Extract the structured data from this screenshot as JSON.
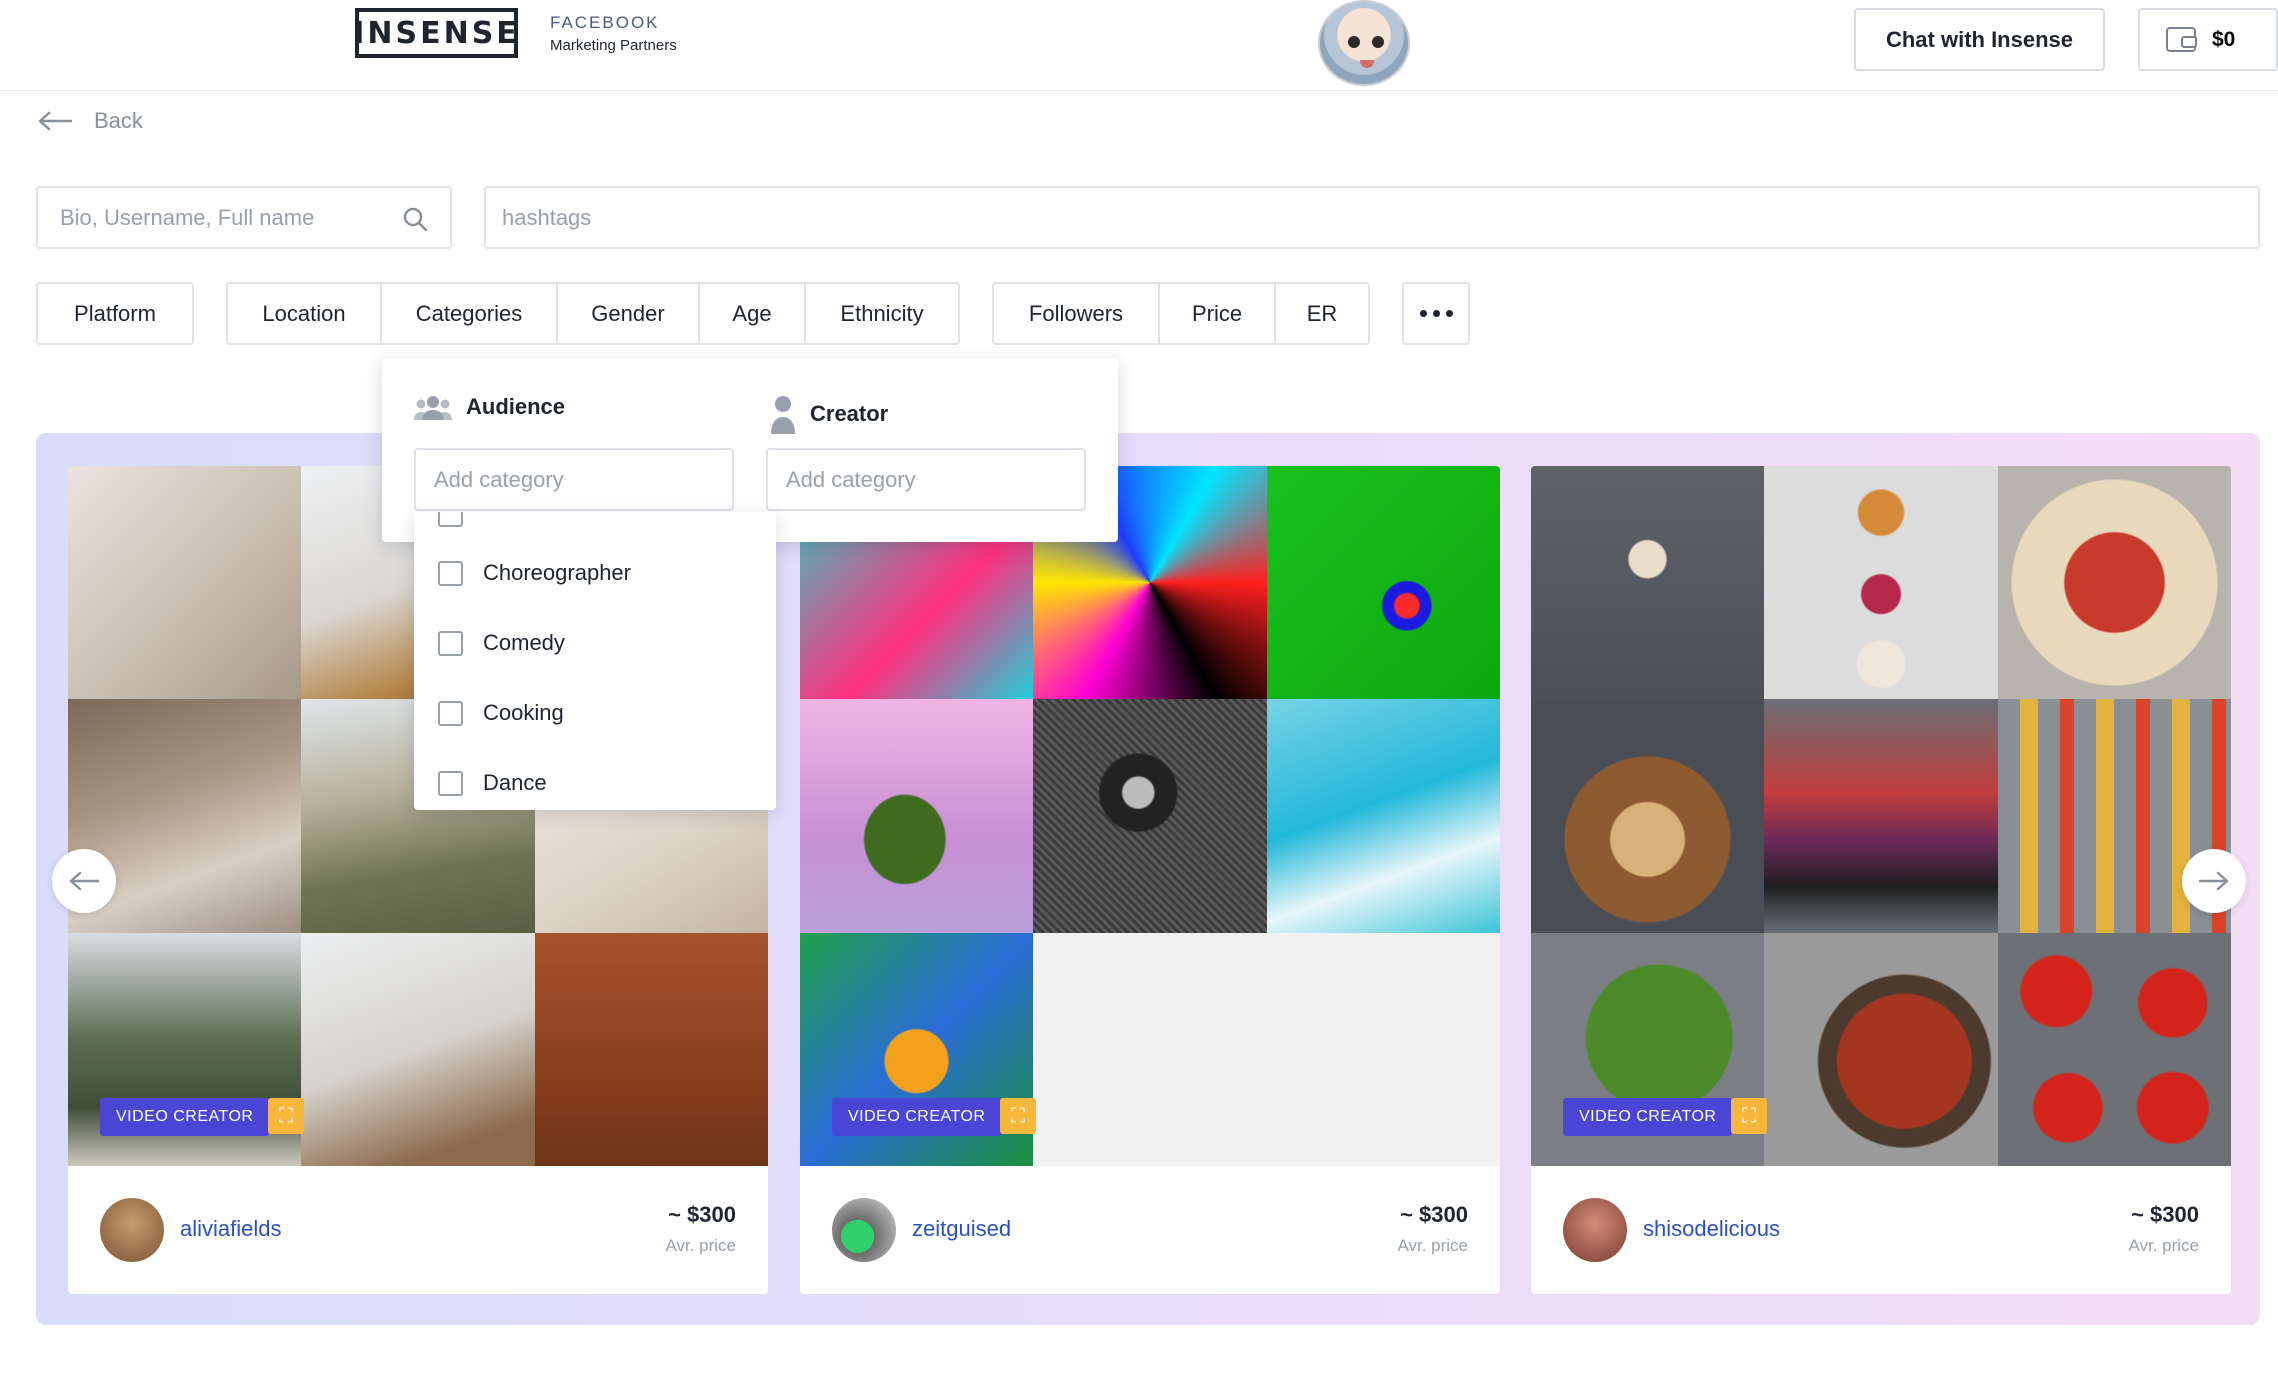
{
  "header": {
    "logo": "INSENSE",
    "partner_line1": "FACEBOOK",
    "partner_line2": "Marketing Partners",
    "chat_label": "Chat with Insense",
    "balance": "$0"
  },
  "nav": {
    "back_label": "Back"
  },
  "search": {
    "placeholder": "Bio, Username, Full name",
    "hashtags_placeholder": "hashtags"
  },
  "filters": {
    "platform": "Platform",
    "location": "Location",
    "categories": "Categories",
    "gender": "Gender",
    "age": "Age",
    "ethnicity": "Ethnicity",
    "followers": "Followers",
    "price": "Price",
    "er": "ER"
  },
  "categories_popup": {
    "audience_label": "Audience",
    "creator_label": "Creator",
    "audience_placeholder": "Add category",
    "creator_placeholder": "Add category",
    "options": [
      "Choreographer",
      "Comedy",
      "Cooking",
      "Dance"
    ]
  },
  "creators": [
    {
      "username": "aliviafields",
      "price": "~ $300",
      "price_label": "Avr. price",
      "badge": "VIDEO CREATOR"
    },
    {
      "username": "zeitguised",
      "price": "~ $300",
      "price_label": "Avr. price",
      "badge": "VIDEO CREATOR"
    },
    {
      "username": "shisodelicious",
      "price": "~ $300",
      "price_label": "Avr. price",
      "badge": "VIDEO CREATOR"
    }
  ],
  "colors": {
    "accent": "#4b45d6",
    "link": "#2b50c4",
    "badge_icon": "#f6b73c"
  }
}
